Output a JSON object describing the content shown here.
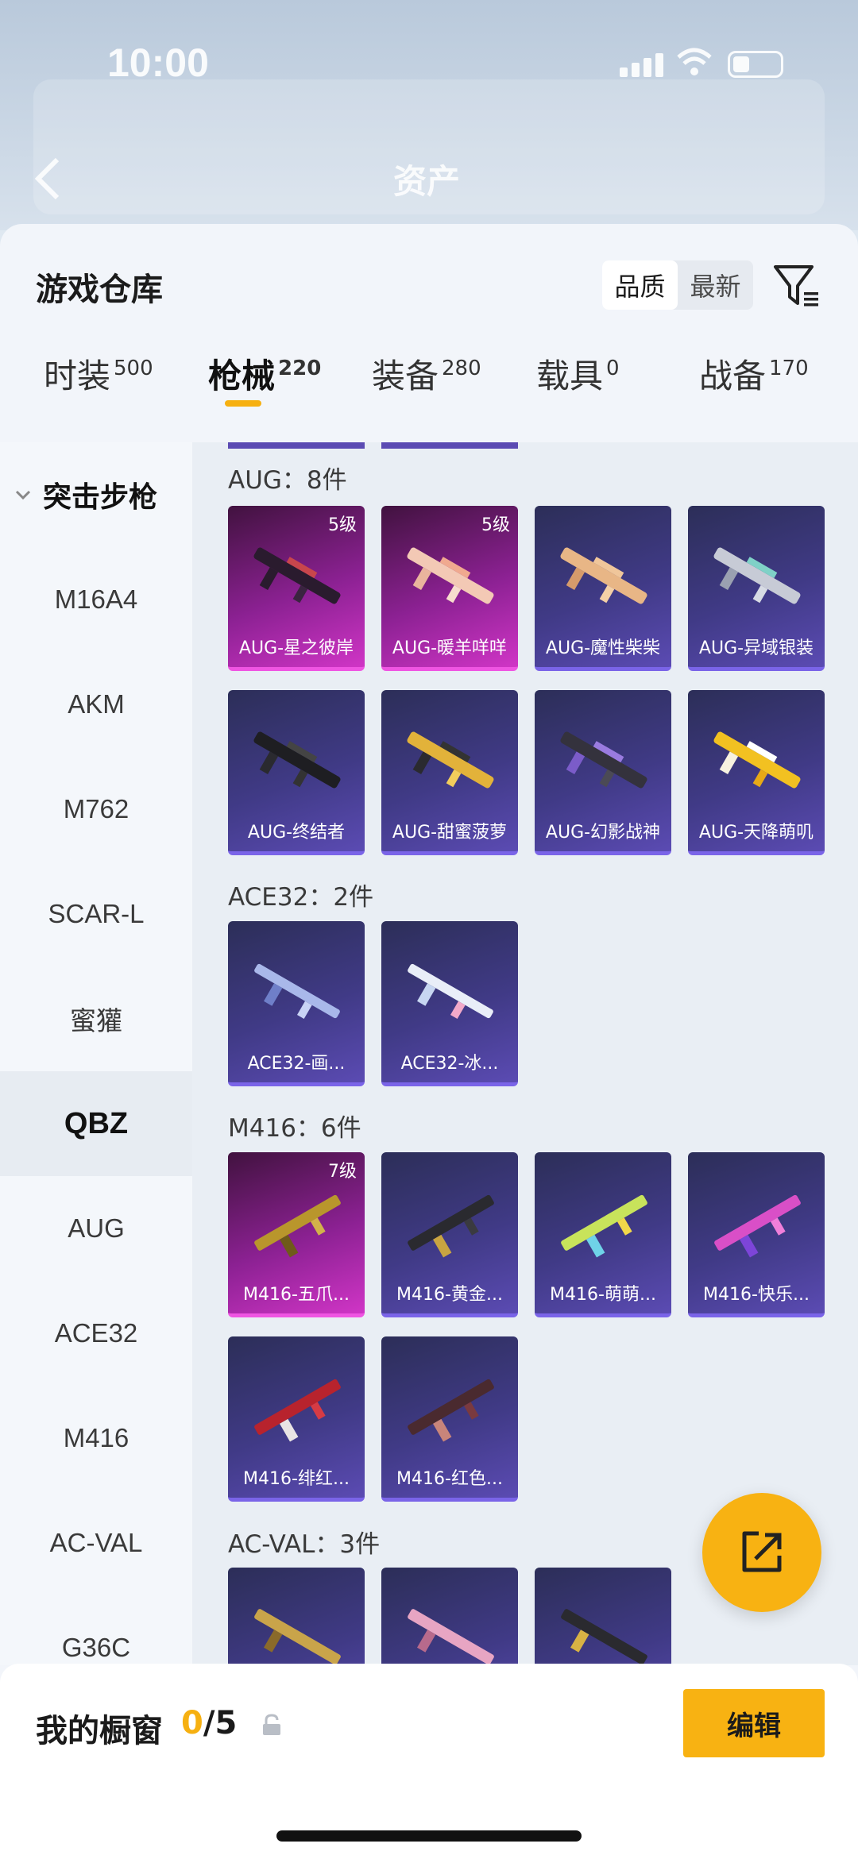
{
  "status_bar": {
    "time": "10:00"
  },
  "background_header": {
    "title": "资产"
  },
  "sheet": {
    "title": "游戏仓库"
  },
  "sort": {
    "options": [
      "品质",
      "最新"
    ],
    "active": "品质"
  },
  "tabs": [
    {
      "label": "时装",
      "count": "500"
    },
    {
      "label": "枪械",
      "count": "220"
    },
    {
      "label": "装备",
      "count": "280"
    },
    {
      "label": "载具",
      "count": "0"
    },
    {
      "label": "战备",
      "count": "170"
    }
  ],
  "active_tab": "枪械",
  "sidebar": {
    "group_label": "突击步枪",
    "items": [
      "M16A4",
      "AKM",
      "M762",
      "SCAR-L",
      "蜜獾",
      "QBZ",
      "AUG",
      "ACE32",
      "M416",
      "AC-VAL",
      "G36C"
    ],
    "active": "QBZ"
  },
  "sections": [
    {
      "title": "AUG：8件",
      "items": [
        {
          "name": "AUG-星之彼岸",
          "level": "5级",
          "rarity": "purple"
        },
        {
          "name": "AUG-暖羊咩咩",
          "level": "5级",
          "rarity": "purple"
        },
        {
          "name": "AUG-魔性柴柴",
          "level": "",
          "rarity": "blue"
        },
        {
          "name": "AUG-异域银装",
          "level": "",
          "rarity": "blue"
        },
        {
          "name": "AUG-终结者",
          "level": "",
          "rarity": "blue"
        },
        {
          "name": "AUG-甜蜜菠萝",
          "level": "",
          "rarity": "blue"
        },
        {
          "name": "AUG-幻影战神",
          "level": "",
          "rarity": "blue"
        },
        {
          "name": "AUG-天降萌叽",
          "level": "",
          "rarity": "blue"
        }
      ]
    },
    {
      "title": "ACE32：2件",
      "items": [
        {
          "name": "ACE32-画...",
          "level": "",
          "rarity": "blue"
        },
        {
          "name": "ACE32-冰...",
          "level": "",
          "rarity": "blue"
        }
      ]
    },
    {
      "title": "M416：6件",
      "items": [
        {
          "name": "M416-五爪...",
          "level": "7级",
          "rarity": "purple"
        },
        {
          "name": "M416-黄金...",
          "level": "",
          "rarity": "blue"
        },
        {
          "name": "M416-萌萌...",
          "level": "",
          "rarity": "blue"
        },
        {
          "name": "M416-快乐...",
          "level": "",
          "rarity": "blue"
        },
        {
          "name": "M416-绯红...",
          "level": "",
          "rarity": "blue"
        },
        {
          "name": "M416-红色...",
          "level": "",
          "rarity": "blue"
        }
      ]
    },
    {
      "title": "AC-VAL：3件",
      "items": [
        {
          "name": "",
          "level": "",
          "rarity": "blue"
        },
        {
          "name": "",
          "level": "",
          "rarity": "blue"
        },
        {
          "name": "",
          "level": "",
          "rarity": "blue"
        }
      ]
    }
  ],
  "showcase": {
    "label": "我的橱窗",
    "current": "0",
    "total": "/5"
  },
  "edit_button": "编辑",
  "colors": {
    "accent": "#f8b212",
    "purple_card": "#d035c6",
    "blue_card": "#5b4bb3"
  }
}
